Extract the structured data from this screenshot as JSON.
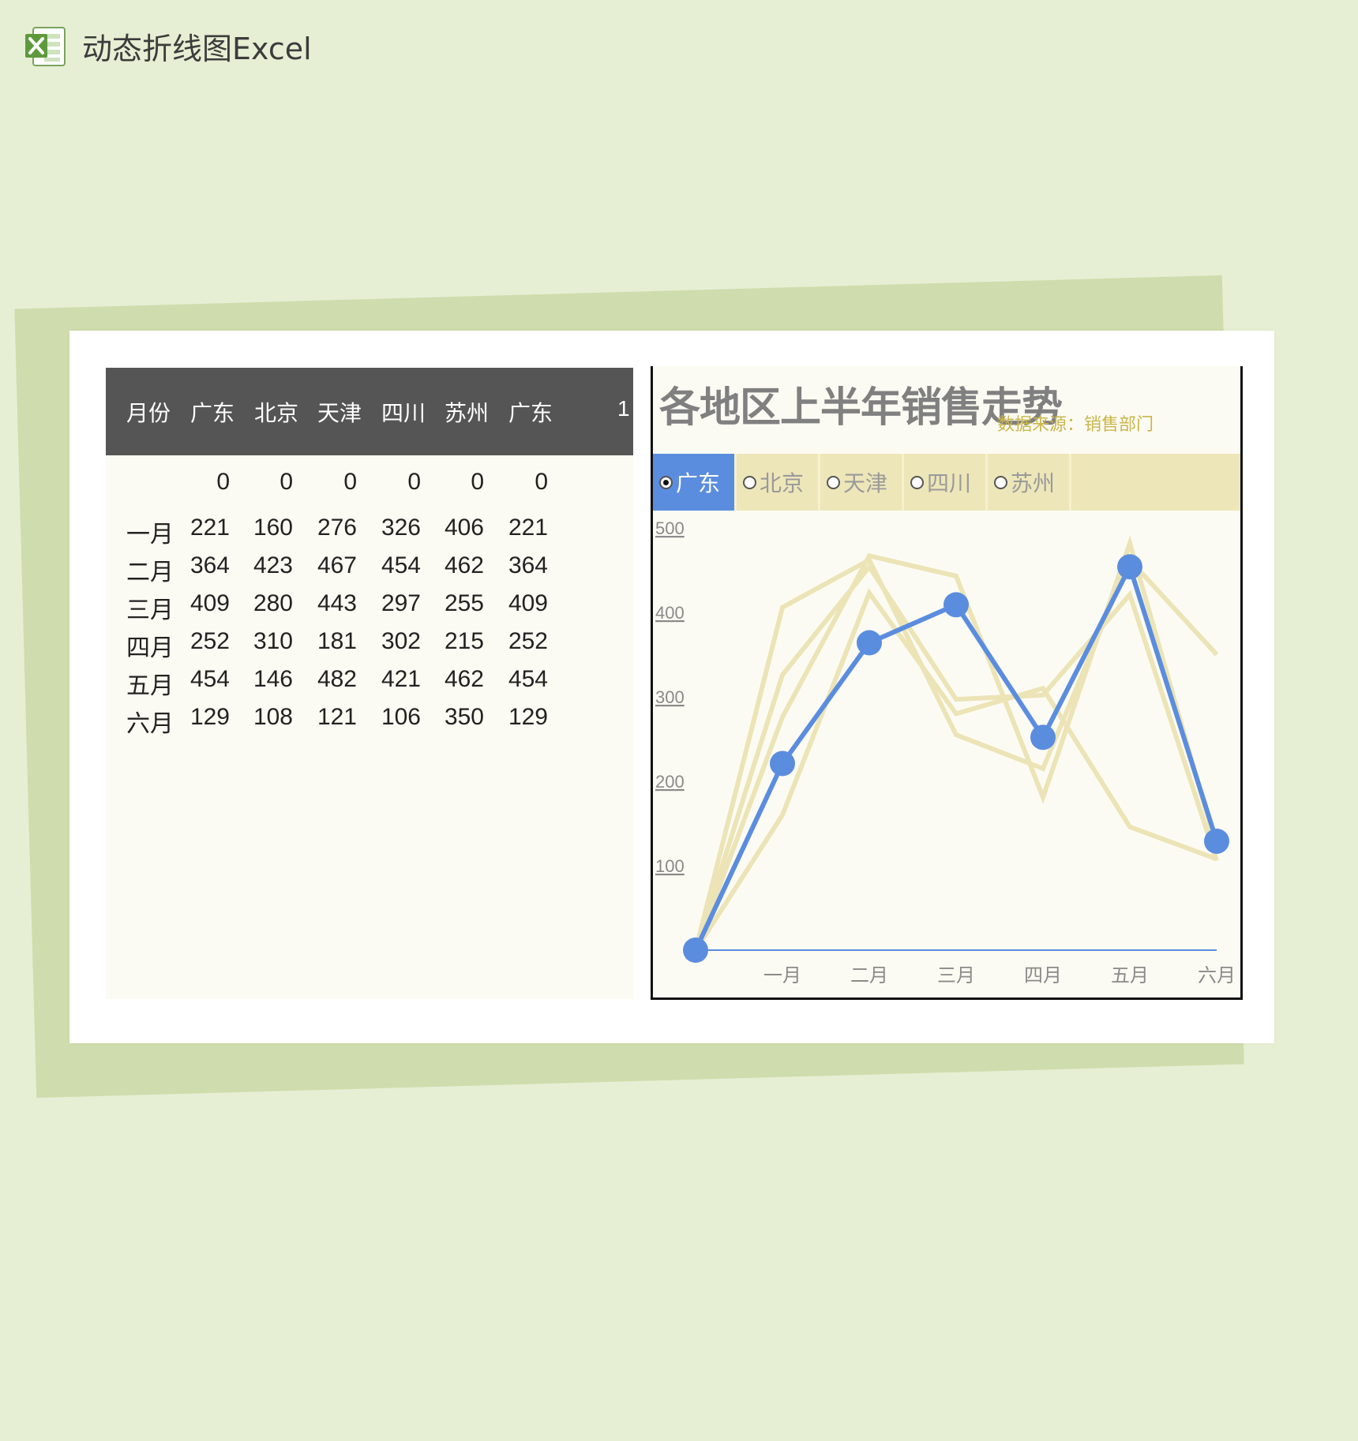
{
  "app": {
    "title": "动态折线图Excel",
    "icon": "excel-icon"
  },
  "table": {
    "headers": [
      "月份",
      "广东",
      "北京",
      "天津",
      "四川",
      "苏州",
      "广东",
      "1"
    ],
    "zero_row": [
      "0",
      "0",
      "0",
      "0",
      "0",
      "0"
    ],
    "rows": [
      {
        "month": "一月",
        "values": [
          "221",
          "160",
          "276",
          "326",
          "406",
          "221"
        ]
      },
      {
        "month": "二月",
        "values": [
          "364",
          "423",
          "467",
          "454",
          "462",
          "364"
        ]
      },
      {
        "month": "三月",
        "values": [
          "409",
          "280",
          "443",
          "297",
          "255",
          "409"
        ]
      },
      {
        "month": "四月",
        "values": [
          "252",
          "310",
          "181",
          "302",
          "215",
          "252"
        ]
      },
      {
        "month": "五月",
        "values": [
          "454",
          "146",
          "482",
          "421",
          "462",
          "454"
        ]
      },
      {
        "month": "六月",
        "values": [
          "129",
          "108",
          "121",
          "106",
          "350",
          "129"
        ]
      }
    ]
  },
  "chart": {
    "title": "各地区上半年销售走势",
    "source": "数据来源：销售部门",
    "selector": {
      "options": [
        "广东",
        "北京",
        "天津",
        "四川",
        "苏州"
      ],
      "selected": "广东"
    }
  },
  "colors": {
    "active": "#5b8ddf",
    "inactive_series": "#ece4b6",
    "header_bg": "#555555",
    "accent_text": "#c9b64a"
  },
  "chart_data": {
    "type": "line",
    "categories": [
      "",
      "一月",
      "二月",
      "三月",
      "四月",
      "五月",
      "六月"
    ],
    "ylim": [
      0,
      500
    ],
    "yticks": [
      "100",
      "200",
      "300",
      "400",
      "500"
    ],
    "highlighted_series": "广东",
    "series": [
      {
        "name": "广东",
        "values": [
          0,
          221,
          364,
          409,
          252,
          454,
          129
        ]
      },
      {
        "name": "北京",
        "values": [
          0,
          160,
          423,
          280,
          310,
          146,
          108
        ]
      },
      {
        "name": "天津",
        "values": [
          0,
          276,
          467,
          443,
          181,
          482,
          121
        ]
      },
      {
        "name": "四川",
        "values": [
          0,
          326,
          454,
          297,
          302,
          421,
          106
        ]
      },
      {
        "name": "苏州",
        "values": [
          0,
          406,
          462,
          255,
          215,
          462,
          350
        ]
      }
    ],
    "grid": false,
    "legend": "none"
  }
}
